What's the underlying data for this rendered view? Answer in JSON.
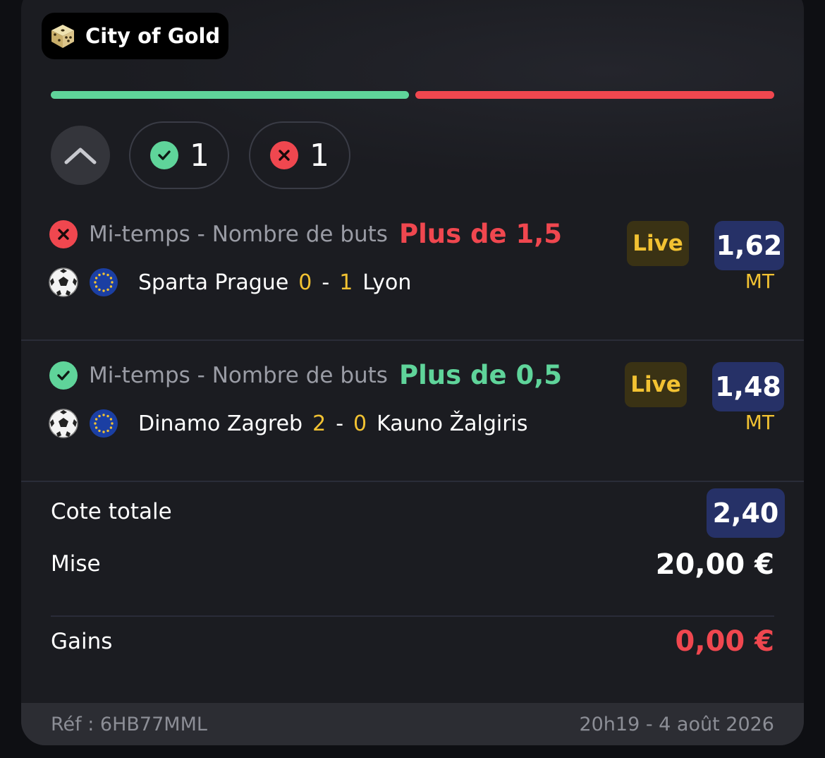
{
  "brand": {
    "name": "City of Gold",
    "icon": "dice-icon"
  },
  "progress": {
    "won_fraction": 0.5,
    "lost_fraction": 0.5,
    "won_color": "#5fd49a",
    "lost_color": "#f0474f"
  },
  "counters": {
    "won_count": "1",
    "lost_count": "1"
  },
  "bets": [
    {
      "status": "lost",
      "market": "Mi-temps - Nombre de buts",
      "selection": "Plus de 1,5",
      "live_label": "Live",
      "odds": "1,62",
      "home_team": "Sparta Prague",
      "home_score": "0",
      "separator": "-",
      "away_score": "1",
      "away_team": "Lyon",
      "period": "MT"
    },
    {
      "status": "won",
      "market": "Mi-temps - Nombre de buts",
      "selection": "Plus de 0,5",
      "live_label": "Live",
      "odds": "1,48",
      "home_team": "Dinamo Zagreb",
      "home_score": "2",
      "separator": "-",
      "away_score": "0",
      "away_team": "Kauno Žalgiris",
      "period": "MT"
    }
  ],
  "summary": {
    "total_odds_label": "Cote totale",
    "total_odds": "2,40",
    "stake_label": "Mise",
    "stake": "20,00 €",
    "gains_label": "Gains",
    "gains": "0,00 €"
  },
  "footer": {
    "reference": "Réf : 6HB77MML",
    "datetime": "20h19 - 4 août 2026"
  }
}
